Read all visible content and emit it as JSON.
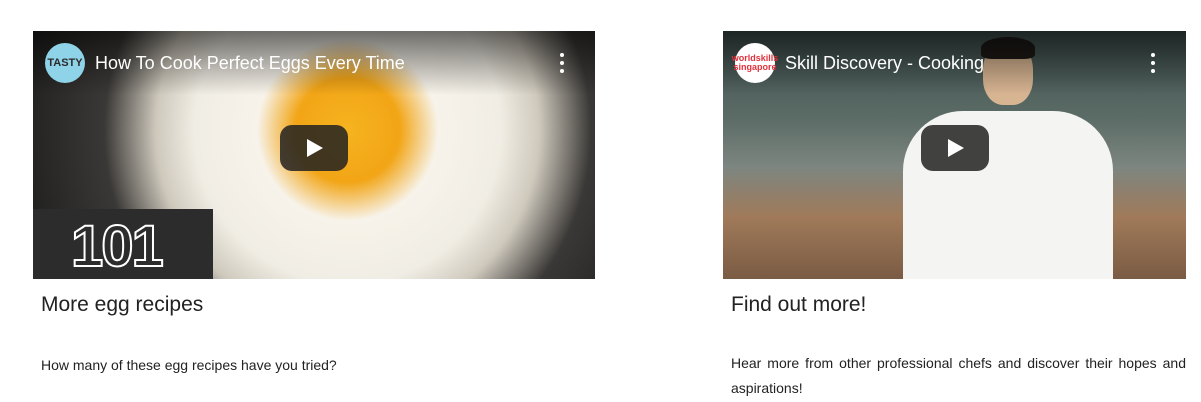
{
  "cards": [
    {
      "video": {
        "title": "How To Cook Perfect Eggs Every Time",
        "channel": "TASTY",
        "badge": "101",
        "more_icon": "more-vert-icon",
        "play_icon": "play-icon"
      },
      "heading": "More egg recipes",
      "text": "How many of these egg recipes have you tried?"
    },
    {
      "video": {
        "title": "Skill Discovery - Cooking",
        "channel": "worldskills singapore",
        "more_icon": "more-vert-icon",
        "play_icon": "play-icon"
      },
      "heading": "Find out more!",
      "text": "Hear more from other professional chefs and discover their hopes and aspirations!"
    }
  ],
  "colors": {
    "play_button_bg": "#212121",
    "text": "#222222",
    "title_text": "#ffffff"
  }
}
